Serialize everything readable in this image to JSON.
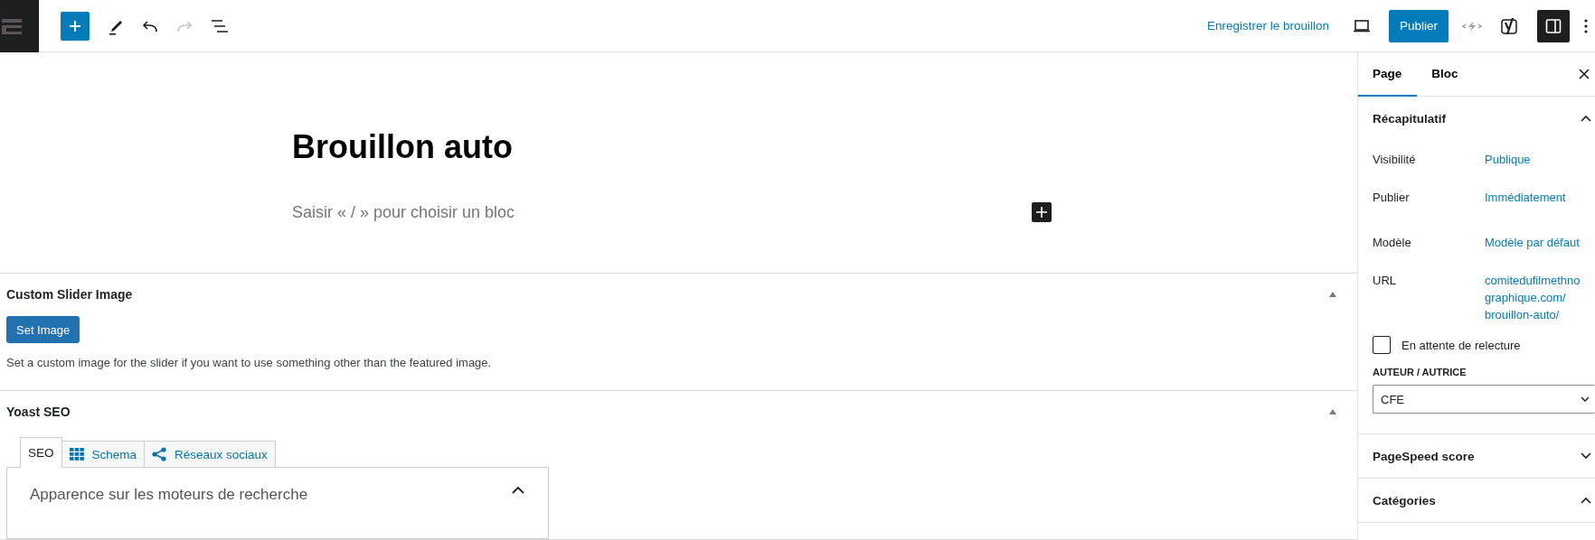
{
  "toolbar": {
    "undo": {
      "disabled": false
    },
    "redo": {
      "disabled": true
    },
    "save_draft": "Enregistrer le brouillon",
    "publish": "Publier",
    "settings_toggle": {
      "pressed": true
    }
  },
  "editor": {
    "title": "Brouillon auto",
    "placeholder": "Saisir « / » pour choisir un bloc"
  },
  "metaboxes": [
    {
      "kind": "slider",
      "title": "Custom Slider Image",
      "expanded": true,
      "button": "Set Image",
      "description": "Set a custom image for the slider if you want to use something other than the featured image."
    },
    {
      "kind": "yoast",
      "title": "Yoast SEO",
      "expanded": true,
      "tabs": [
        {
          "label": "SEO",
          "selected": true
        },
        {
          "label": "Schema",
          "selected": false
        },
        {
          "label": "Réseaux sociaux",
          "selected": false
        }
      ],
      "section": {
        "title": "Apparence sur les moteurs de recherche",
        "expanded": true
      }
    }
  ],
  "sidebar": {
    "tabs": [
      {
        "label": "Page",
        "selected": true
      },
      {
        "label": "Bloc",
        "selected": false
      }
    ],
    "panels": [
      {
        "title": "Récapitulatif",
        "expanded": true,
        "rows": [
          {
            "label": "Visibilité",
            "lines": [
              "Publique"
            ]
          },
          {
            "label": "Publier",
            "lines": [
              "Immédiatement"
            ]
          },
          {
            "label": "Modèle",
            "lines": [
              "Modèle par défaut"
            ]
          },
          {
            "label": "URL",
            "lines": [
              "comitedufilmethno",
              "graphique.com/",
              "brouillon-auto/"
            ]
          }
        ],
        "checkbox": {
          "label": "En attente de relecture",
          "checked": false
        },
        "author": {
          "label": "AUTEUR / AUTRICE",
          "value": "CFE"
        }
      },
      {
        "title": "PageSpeed score",
        "expanded": false
      },
      {
        "title": "Catégories",
        "expanded": true
      }
    ]
  }
}
